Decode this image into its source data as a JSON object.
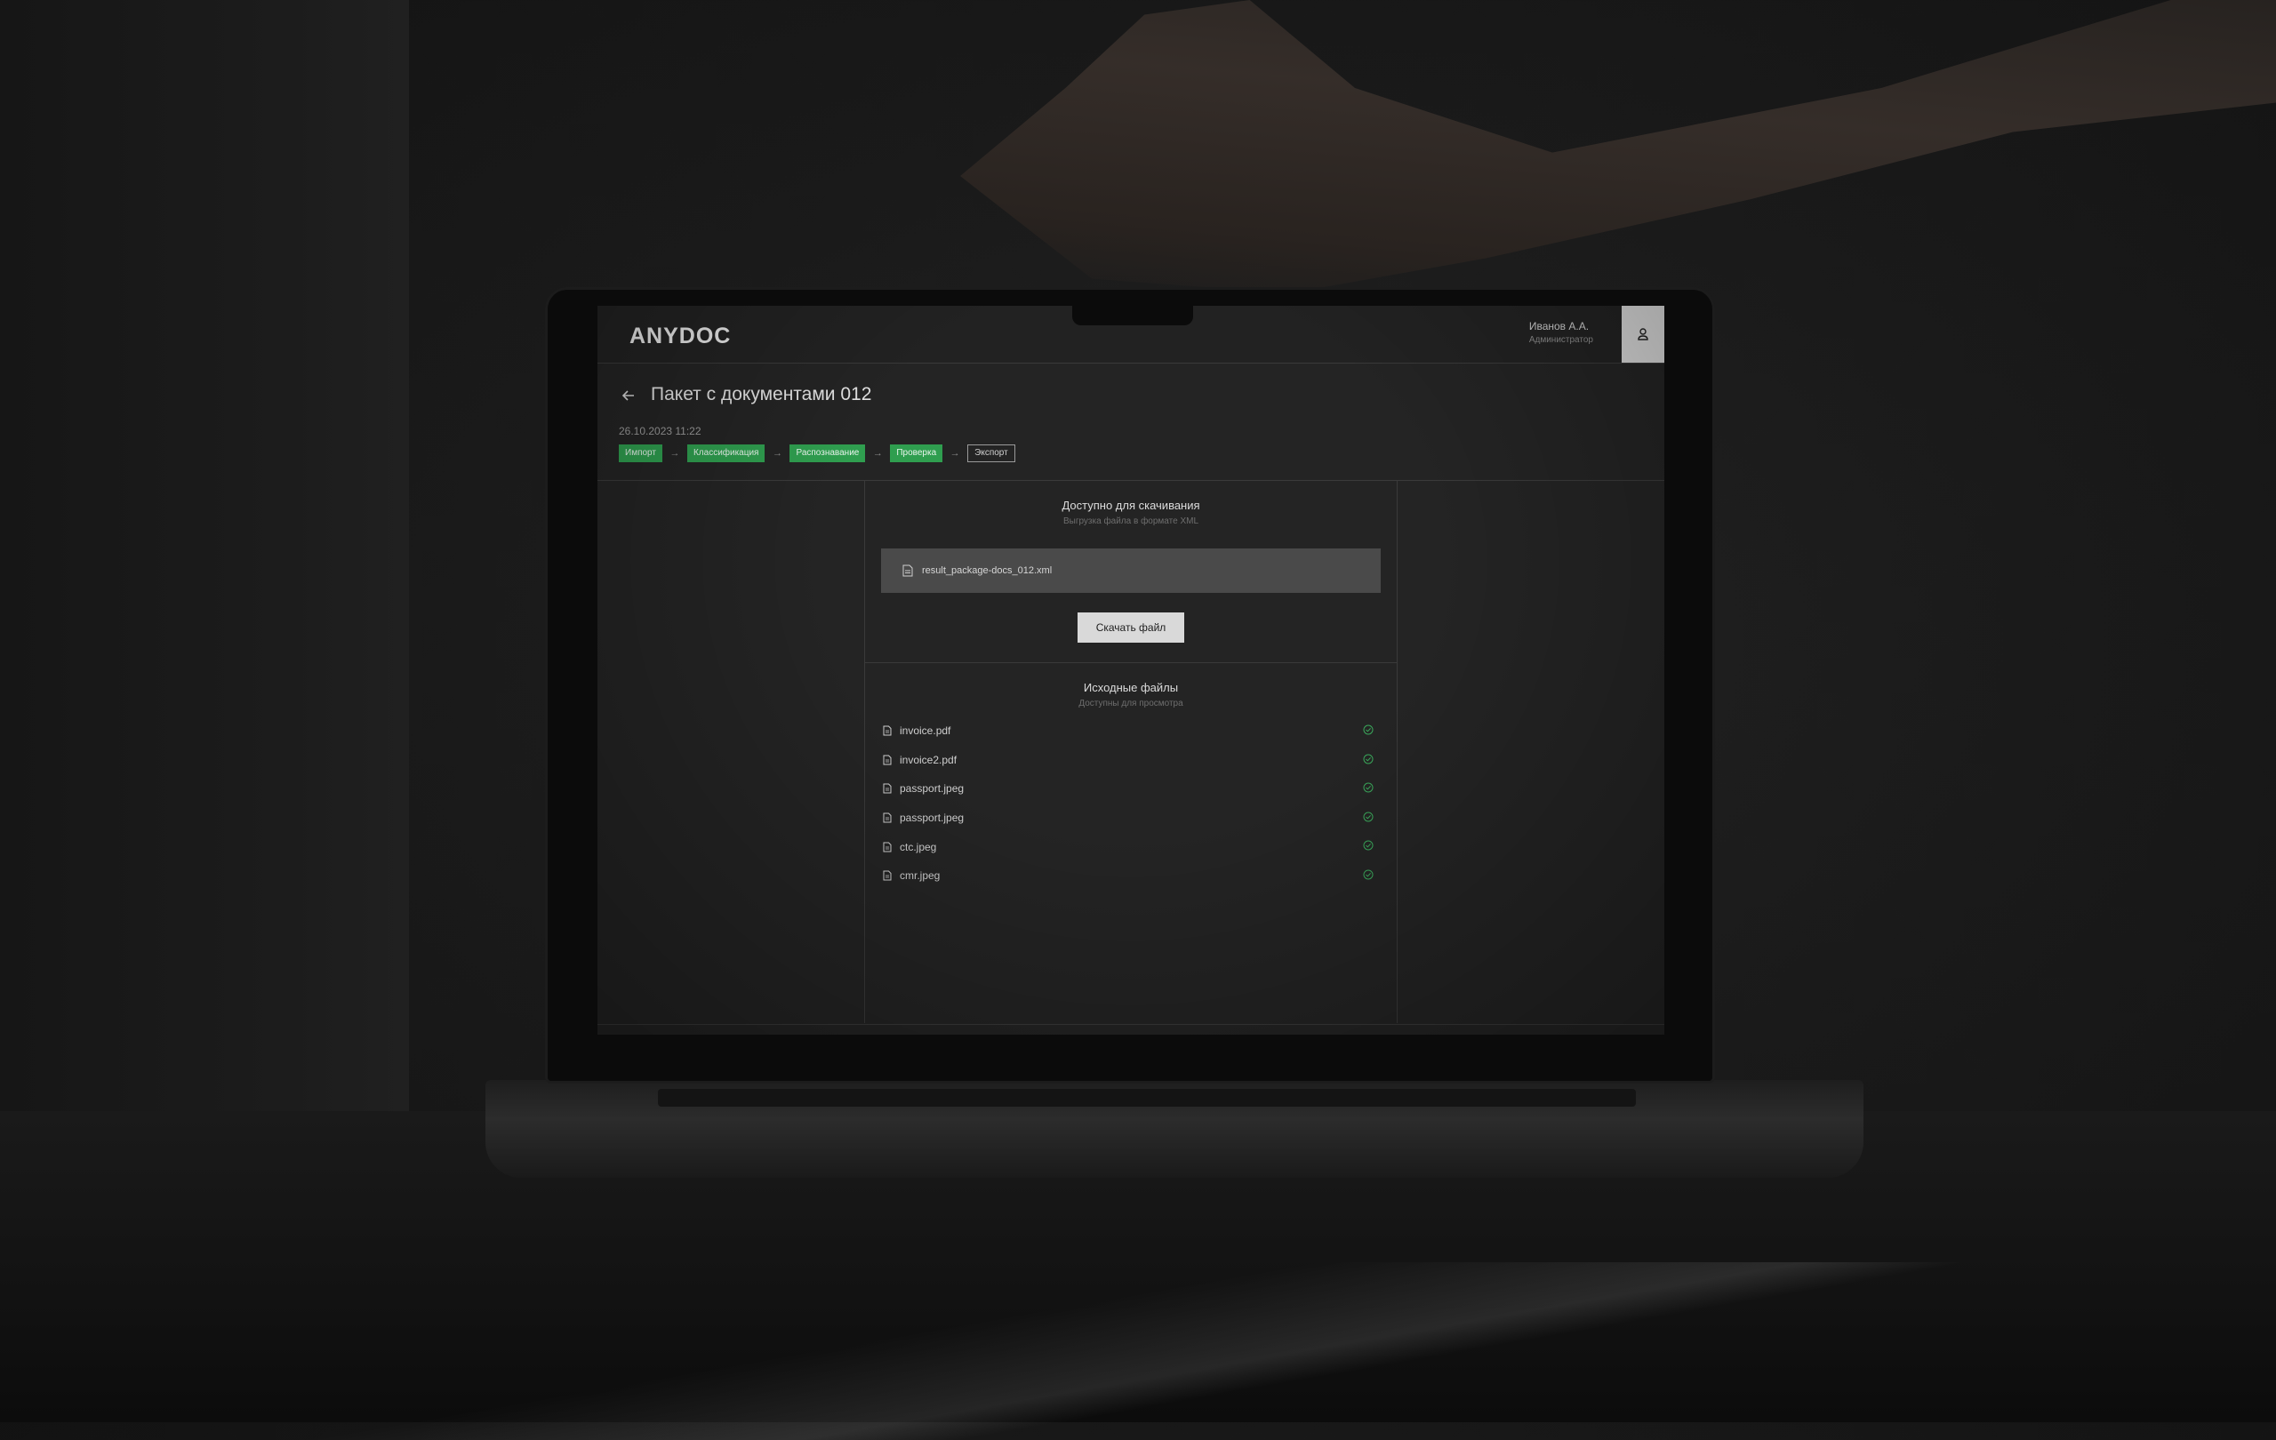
{
  "header": {
    "logo": "ANYDOC",
    "user_name": "Иванов А.А.",
    "user_role": "Администратор",
    "user_icon": "user-icon"
  },
  "page": {
    "title": "Пакет с документами 012",
    "date": "26.10.2023 11:22",
    "back_icon": "arrow-left-icon"
  },
  "stages": [
    {
      "label": "Импорт",
      "state": "done"
    },
    {
      "label": "Классификация",
      "state": "done"
    },
    {
      "label": "Распознавание",
      "state": "done"
    },
    {
      "label": "Проверка",
      "state": "done"
    },
    {
      "label": "Экспорт",
      "state": "current"
    }
  ],
  "download": {
    "title": "Доступно для скачивания",
    "subtitle": "Выгрузка файла в формате XML",
    "file_name": "result_package-docs_012.xml",
    "button_label": "Скачать файл"
  },
  "source": {
    "title": "Исходные файлы",
    "subtitle": "Доступны для просмотра",
    "files": [
      {
        "name": "invoice.pdf",
        "status": "check-circle-icon"
      },
      {
        "name": "invoice2.pdf",
        "status": "check-circle-icon"
      },
      {
        "name": "passport.jpeg",
        "status": "check-circle-icon"
      },
      {
        "name": "passport.jpeg",
        "status": "check-circle-icon"
      },
      {
        "name": "ctc.jpeg",
        "status": "check-circle-icon"
      },
      {
        "name": "cmr.jpeg",
        "status": "check-circle-icon"
      }
    ]
  },
  "colors": {
    "stage_done": "#2f9e4f",
    "check": "#3aa65a",
    "screen_bg": "#242424"
  }
}
